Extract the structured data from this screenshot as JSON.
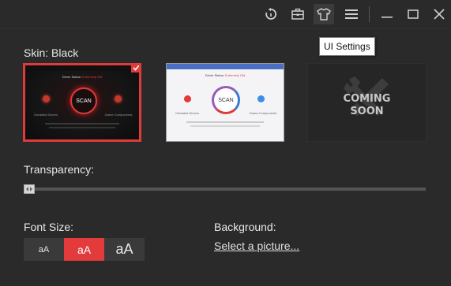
{
  "tooltip": {
    "text": "UI Settings"
  },
  "skin": {
    "label": "Skin: Black",
    "options": [
      {
        "name": "Black",
        "selected": true,
        "preview": {
          "status_title": "Driver Status:",
          "status_value": "Extremely Old",
          "scan": "SCAN",
          "left_caption": "Outdated Drivers",
          "right_caption": "Game Components"
        }
      },
      {
        "name": "White",
        "selected": false,
        "preview": {
          "status_title": "Driver Status:",
          "status_value": "Extremely Old",
          "scan": "SCAN",
          "left_caption": "Outdated Drivers",
          "right_caption": "Game Components"
        }
      },
      {
        "name": "Coming Soon",
        "selected": false,
        "line1": "COMING",
        "line2": "SOON"
      }
    ]
  },
  "transparency": {
    "label": "Transparency:",
    "value": 0
  },
  "font_size": {
    "label": "Font Size:",
    "options": [
      "aA",
      "aA",
      "aA"
    ],
    "selected_index": 1
  },
  "background": {
    "label": "Background:",
    "link": "Select a picture..."
  },
  "icons": {
    "restore": "restore-icon",
    "toolbox": "toolbox-icon",
    "skin": "tshirt-icon",
    "menu": "menu-icon",
    "minimize": "minimize-icon",
    "maximize": "maximize-icon",
    "close": "close-icon",
    "tools": "wrench-screwdriver-icon"
  },
  "colors": {
    "accent": "#e33b3b",
    "background": "#2a2a2a",
    "text": "#e6e6e6"
  }
}
